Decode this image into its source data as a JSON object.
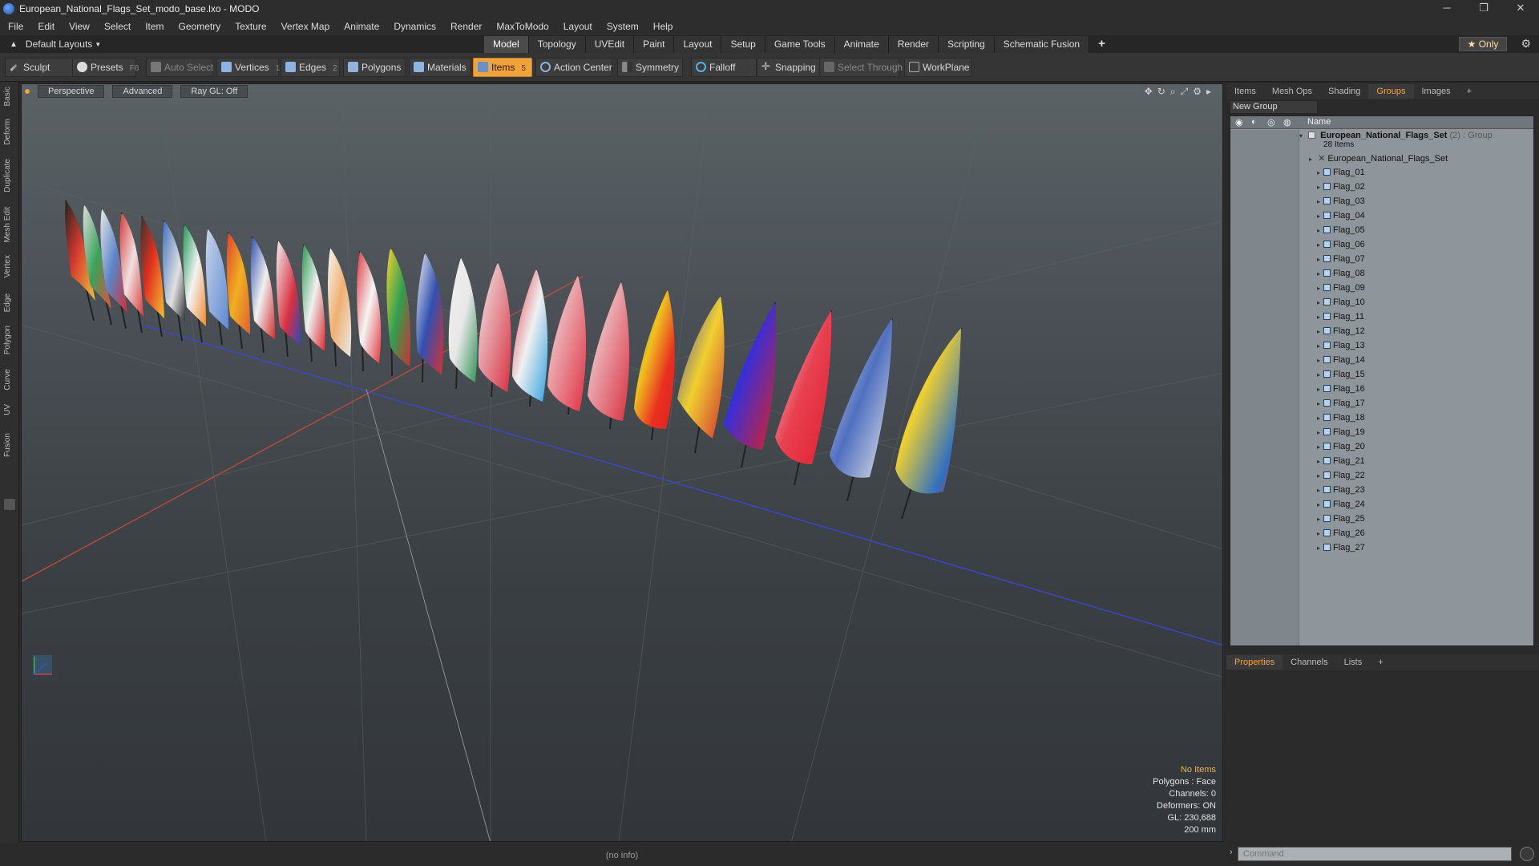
{
  "window": {
    "title": "European_National_Flags_Set_modo_base.lxo - MODO",
    "controls": [
      "─",
      "❐",
      "✕"
    ]
  },
  "menu": [
    "File",
    "Edit",
    "View",
    "Select",
    "Item",
    "Geometry",
    "Texture",
    "Vertex Map",
    "Animate",
    "Dynamics",
    "Render",
    "MaxToModo",
    "Layout",
    "System",
    "Help"
  ],
  "layoutbar": {
    "layout_dropdown": "Default Layouts",
    "tabs": [
      "Model",
      "Topology",
      "UVEdit",
      "Paint",
      "Layout",
      "Setup",
      "Game Tools",
      "Animate",
      "Render",
      "Scripting",
      "Schematic Fusion"
    ],
    "active_tab": "Model",
    "add_tab": "+",
    "only_button": "Only",
    "only_star": "★"
  },
  "toolbar": {
    "sculpt": "Sculpt",
    "presets": "Presets",
    "presets_key": "F6",
    "auto_select": "Auto Select",
    "vertices": "Vertices",
    "vertices_key": "1",
    "edges": "Edges",
    "edges_key": "2",
    "polygons": "Polygons",
    "materials": "Materials",
    "items": "Items",
    "items_key": "5",
    "action_center": "Action Center",
    "symmetry": "Symmetry",
    "falloff": "Falloff",
    "snapping": "Snapping",
    "select_through": "Select Through",
    "workplane": "WorkPlane"
  },
  "left_tabs": [
    "Basic",
    "Deform",
    "Duplicate",
    "Mesh Edit",
    "Vertex",
    "Edge",
    "Polygon",
    "Curve",
    "UV",
    "Fusion"
  ],
  "viewport": {
    "view": "Perspective",
    "shading": "Advanced",
    "raygl": "Ray GL: Off",
    "info": {
      "selection": "No Items",
      "polygons": "Polygons : Face",
      "channels": "Channels: 0",
      "deformers": "Deformers: ON",
      "gl": "GL: 230,688",
      "scale": "200 mm"
    }
  },
  "status": "(no info)",
  "right_panel": {
    "tabs": [
      "Items",
      "Mesh Ops",
      "Shading",
      "Groups",
      "Images"
    ],
    "active_tab": "Groups",
    "add_tab": "+",
    "new_group": "New Group",
    "name_header": "Name",
    "group_name": "European_National_Flags_Set",
    "group_count": "(2)",
    "group_type": ": Group",
    "group_items": "28 Items",
    "mesh_item": "European_National_Flags_Set",
    "flags": [
      "Flag_01",
      "Flag_02",
      "Flag_03",
      "Flag_04",
      "Flag_05",
      "Flag_06",
      "Flag_07",
      "Flag_08",
      "Flag_09",
      "Flag_10",
      "Flag_11",
      "Flag_12",
      "Flag_13",
      "Flag_14",
      "Flag_15",
      "Flag_16",
      "Flag_17",
      "Flag_18",
      "Flag_19",
      "Flag_20",
      "Flag_21",
      "Flag_22",
      "Flag_23",
      "Flag_24",
      "Flag_25",
      "Flag_26",
      "Flag_27"
    ],
    "props_tabs": [
      "Properties",
      "Channels",
      "Lists"
    ],
    "props_active": "Properties",
    "command_placeholder": "Command"
  },
  "colors": {
    "accent": "#f0a23c",
    "x_axis": "#d0483c",
    "z_axis": "#3b46d8"
  }
}
